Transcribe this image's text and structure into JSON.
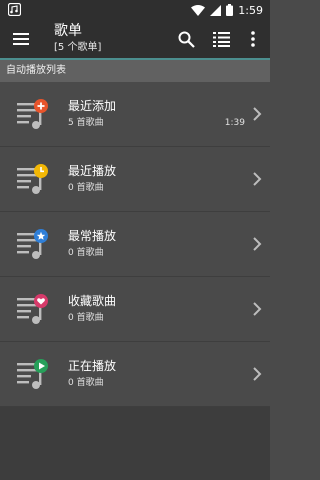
{
  "status_bar": {
    "time": "1:59",
    "icons": [
      "app-notification-icon",
      "wifi-icon",
      "signal-icon",
      "battery-icon"
    ]
  },
  "app_bar": {
    "title": "歌单",
    "subtitle": "[5 个歌单]",
    "actions": [
      "menu-icon",
      "search-icon",
      "list-view-icon",
      "more-vert-icon"
    ]
  },
  "section": {
    "title": "自动播放列表"
  },
  "playlists": [
    {
      "name": "最近添加",
      "count": "5 首歌曲",
      "duration": "1:39",
      "badge": "plus",
      "badge_color": "#e8542b"
    },
    {
      "name": "最近播放",
      "count": "0 首歌曲",
      "duration": "",
      "badge": "clock",
      "badge_color": "#f2b705"
    },
    {
      "name": "最常播放",
      "count": "0 首歌曲",
      "duration": "",
      "badge": "star",
      "badge_color": "#2f7fd8"
    },
    {
      "name": "收藏歌曲",
      "count": "0 首歌曲",
      "duration": "",
      "badge": "heart",
      "badge_color": "#d63a6a"
    },
    {
      "name": "正在播放",
      "count": "0 首歌曲",
      "duration": "",
      "badge": "play",
      "badge_color": "#27a05a"
    }
  ],
  "colors": {
    "background": "#4a4a4a",
    "toolbar": "#2f2f2f",
    "accent": "#4c8f8f",
    "section": "#616161"
  }
}
